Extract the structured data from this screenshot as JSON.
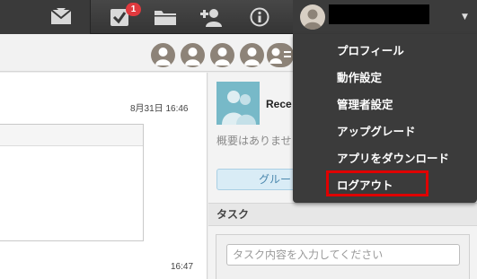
{
  "header": {
    "task_badge_count": "1",
    "icons": [
      "mail-icon",
      "task-check-icon",
      "folder-icon",
      "add-contact-icon",
      "info-icon",
      "user-avatar-icon"
    ]
  },
  "timestamps": {
    "first": "8月31日 16:46",
    "second": "16:47"
  },
  "group": {
    "name": "Rece",
    "description": "概要はありませ",
    "button_label": "グルー"
  },
  "task": {
    "section_title": "タスク",
    "input_placeholder": "タスク内容を入力してください"
  },
  "user_menu": {
    "items": [
      {
        "label": "プロフィール"
      },
      {
        "label": "動作設定"
      },
      {
        "label": "管理者設定"
      },
      {
        "label": "アップグレード"
      },
      {
        "label": "アプリをダウンロード"
      },
      {
        "label": "ログアウト"
      }
    ],
    "highlighted_item": "ログアウト"
  },
  "colors": {
    "topbar": "#3b3b3b",
    "badge": "#e0393e",
    "highlight": "#e00000",
    "group_thumb": "#77b9c8"
  }
}
